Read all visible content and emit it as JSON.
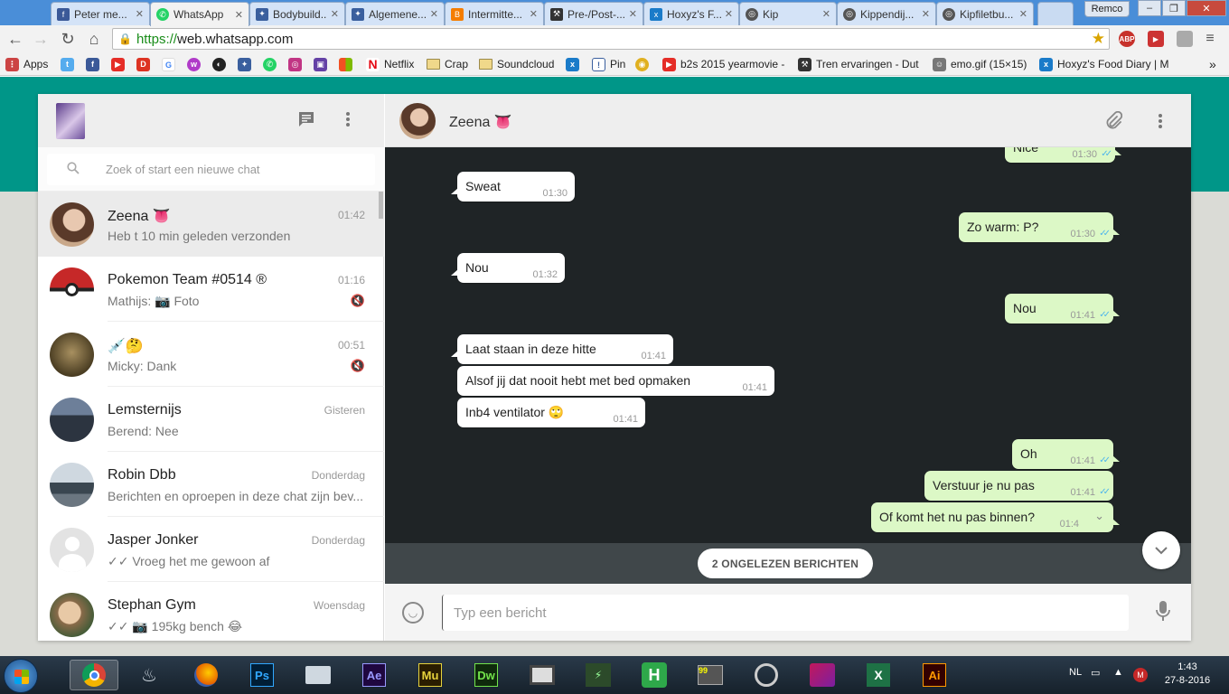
{
  "browser": {
    "tabs": [
      {
        "title": "Peter me..."
      },
      {
        "title": "WhatsApp"
      },
      {
        "title": "Bodybuild..."
      },
      {
        "title": "Algemene..."
      },
      {
        "title": "Intermitte..."
      },
      {
        "title": "Pre-/Post-..."
      },
      {
        "title": "Hoxyz's F..."
      },
      {
        "title": "Kip"
      },
      {
        "title": "Kippendij..."
      },
      {
        "title": "Kipfiletbu..."
      }
    ],
    "profile_name": "Remco",
    "url_scheme": "https://",
    "url_host": "web.whatsapp.com",
    "bookmarks": [
      {
        "label": "Apps"
      },
      {
        "label": "Netflix"
      },
      {
        "label": "Crap"
      },
      {
        "label": "Soundcloud"
      },
      {
        "label": "Pin"
      },
      {
        "label": "b2s 2015 yearmovie -"
      },
      {
        "label": "Tren ervaringen - Dut"
      },
      {
        "label": "emo.gif (15×15)"
      },
      {
        "label": "Hoxyz's Food Diary | M"
      }
    ]
  },
  "sidebar": {
    "search_placeholder": "Zoek of start een nieuwe chat",
    "chats": [
      {
        "name": "Zeena 👅",
        "time": "01:42",
        "preview": "Heb t 10 min geleden verzonden",
        "selected": true
      },
      {
        "name": "Pokemon Team #0514 ®",
        "time": "01:16",
        "preview": "Mathijs: 📷 Foto",
        "muted": true
      },
      {
        "name": "💉🤔",
        "time": "00:51",
        "preview": "Micky: Dank",
        "muted": true
      },
      {
        "name": "Lemsternijs",
        "time": "Gisteren",
        "preview": "Berend: Nee"
      },
      {
        "name": "Robin Dbb",
        "time": "Donderdag",
        "preview": "Berichten en oproepen in deze chat zijn bev..."
      },
      {
        "name": "Jasper Jonker",
        "time": "Donderdag",
        "preview": "✓✓ Vroeg het me gewoon af"
      },
      {
        "name": "Stephan Gym",
        "time": "Woensdag",
        "preview": "✓✓ 📷 195kg bench 😂"
      }
    ]
  },
  "conversation": {
    "contact_name": "Zeena 👅",
    "messages": [
      {
        "dir": "out",
        "text": "Nice",
        "time": "01:30"
      },
      {
        "dir": "in",
        "text": "Sweat",
        "time": "01:30"
      },
      {
        "dir": "out",
        "text": "Zo warm: P?",
        "time": "01:30"
      },
      {
        "dir": "in",
        "text": "Nou",
        "time": "01:32"
      },
      {
        "dir": "out",
        "text": "Nou",
        "time": "01:41"
      },
      {
        "dir": "in",
        "text": "Laat staan in deze hitte",
        "time": "01:41"
      },
      {
        "dir": "in",
        "text": "Alsof jij dat nooit hebt met bed opmaken",
        "time": "01:41"
      },
      {
        "dir": "in",
        "text": "Inb4 ventilator 🙄",
        "time": "01:41"
      },
      {
        "dir": "out",
        "text": "Oh",
        "time": "01:41"
      },
      {
        "dir": "out",
        "text": "Verstuur je nu pas",
        "time": "01:41"
      },
      {
        "dir": "out",
        "text": "Of komt het nu pas binnen?",
        "time": "01:4"
      }
    ],
    "unread_label": "2 ONGELEZEN BERICHTEN",
    "compose_placeholder": "Typ een bericht"
  },
  "taskbar": {
    "language": "NL",
    "time": "1:43",
    "date": "27-8-2016"
  },
  "colors": {
    "teal": "#009688",
    "bubble_out": "#dcf8c6",
    "bubble_in": "#ffffff",
    "chat_bg": "#1f2426",
    "check_blue": "#4fb6ec"
  }
}
